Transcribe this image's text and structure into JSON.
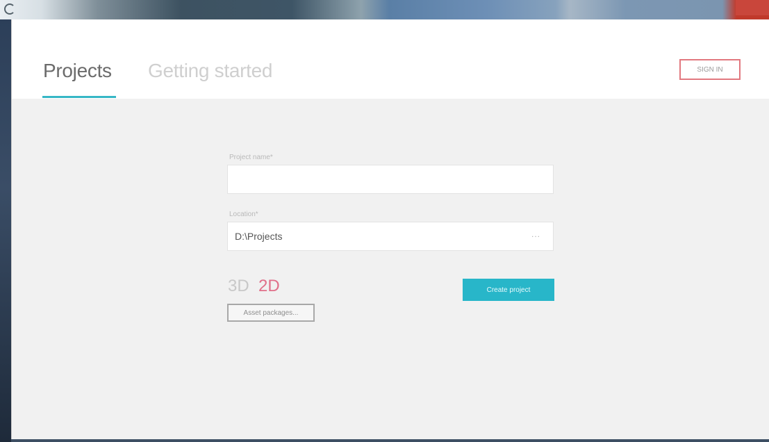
{
  "tabs": {
    "projects": "Projects",
    "getting_started": "Getting started"
  },
  "header": {
    "signin_label": "SIGN IN"
  },
  "form": {
    "project_name_label": "Project name*",
    "project_name_value": "",
    "location_label": "Location*",
    "location_value": "D:\\Projects",
    "browse_label": "...",
    "mode_3d": "3D",
    "mode_2d": "2D",
    "asset_packages_label": "Asset packages...",
    "create_project_label": "Create project"
  },
  "colors": {
    "accent": "#28b6c9",
    "signin_border": "#e2787f",
    "mode_selected": "#e0708a"
  }
}
